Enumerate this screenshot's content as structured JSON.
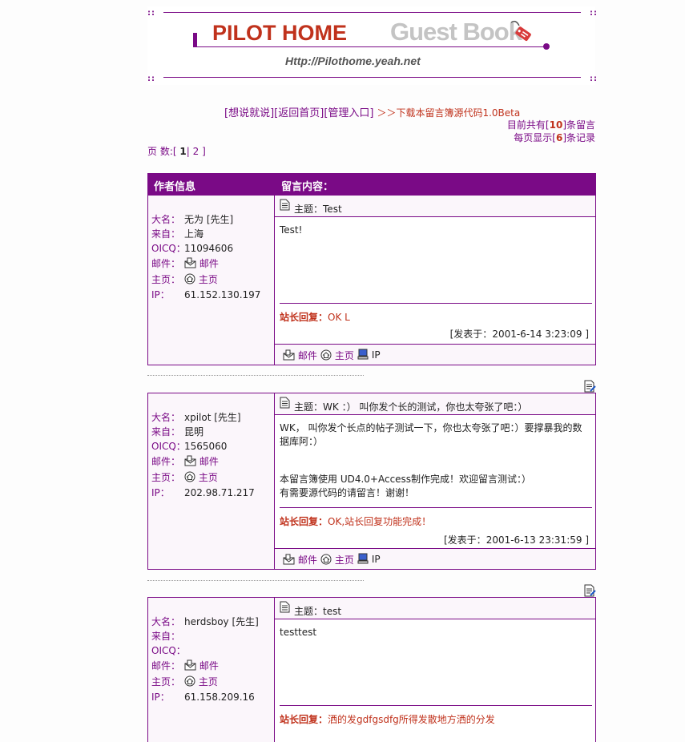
{
  "banner": {
    "title": "PILOT HOME",
    "subtitle": "Guest Book",
    "url": "Http://Pilothome.yeah.net",
    "dots": "::"
  },
  "nav": {
    "post_label": "[想说就说]",
    "home_label": "[返回首页]",
    "admin_label": "[管理入口]",
    "download_label": "＞＞下载本留言簿源代码1.0Beta"
  },
  "stats": {
    "total_prefix": "目前共有[",
    "total": "10",
    "total_suffix": "]条留言",
    "per_page_prefix": "每页显示[",
    "per_page": "6",
    "per_page_suffix": "]条记录"
  },
  "pager": {
    "label": "页 数:[",
    "current": "1",
    "sep": "|",
    "next": "2",
    "end": " ]"
  },
  "table": {
    "col_author": "作者信息",
    "col_content": "留言内容："
  },
  "labels": {
    "name": "大名：",
    "from": "来自：",
    "oicq": "OICQ：",
    "mail": "邮件：",
    "home": "主页：",
    "ip": "IP：",
    "mail_link": "邮件",
    "home_link": "主页",
    "ip_link": "IP",
    "subject": "主题：",
    "reply": "站长回复：",
    "posted_prefix": "[发表于：",
    "posted_suffix": " ]"
  },
  "entries": [
    {
      "name": "无为 [先生]",
      "from": "上海",
      "oicq": "11094606",
      "ip": "61.152.130.197",
      "subject": "Test",
      "body": [
        "Test!"
      ],
      "reply": "OK L",
      "posted": "2001-6-14 3:23:09"
    },
    {
      "name": "xpilot [先生]",
      "from": "昆明",
      "oicq": "1565060",
      "ip": "202.98.71.217",
      "subject": "WK ：） 叫你发个长的测试，你也太夸张了吧：）",
      "body": [
        "WK， 叫你发个长点的帖子测试一下，你也太夸张了吧：）要撑暴我的数",
        "据库阿：）",
        "",
        "",
        "本留言簿使用 UD4.0+Access制作完成！欢迎留言测试：）",
        "有需要源代码的请留言！谢谢！"
      ],
      "reply": "OK,站长回复功能完成！",
      "posted": "2001-6-13 23:31:59"
    },
    {
      "name": "herdsboy [先生]",
      "from": "",
      "oicq": "",
      "ip": "61.158.209.16",
      "subject": "test",
      "body": [
        "testtest"
      ],
      "reply": "洒的发gdfgsdfg所得发散地方洒的分发",
      "posted": ""
    }
  ]
}
